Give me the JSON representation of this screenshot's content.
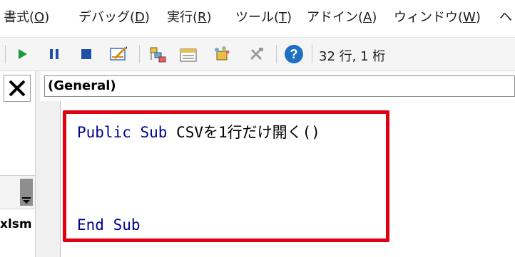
{
  "menu": [
    {
      "id": "format",
      "label": "書式(",
      "key": "O",
      "suffix": ")"
    },
    {
      "id": "debug",
      "label": "デバッグ(",
      "key": "D",
      "suffix": ")"
    },
    {
      "id": "run",
      "label": "実行(",
      "key": "R",
      "suffix": ")"
    },
    {
      "id": "tools",
      "label": "ツール(",
      "key": "T",
      "suffix": ")"
    },
    {
      "id": "addins",
      "label": "アドイン(",
      "key": "A",
      "suffix": ")"
    },
    {
      "id": "window",
      "label": "ウィンドウ(",
      "key": "W",
      "suffix": ")"
    },
    {
      "id": "help",
      "label": "ヘ",
      "key": "",
      "suffix": ""
    }
  ],
  "toolbar": {
    "icons": [
      "run-icon",
      "pause-icon",
      "stop-icon",
      "design-mode-icon",
      "project-explorer-icon",
      "properties-icon",
      "object-browser-icon",
      "toolbox-icon",
      "help-icon"
    ],
    "status": "32 行, 1 桁",
    "colors": {
      "run": "#1a9b3c",
      "pause": "#1f4fa8",
      "stop": "#1f4fa8",
      "help": "#1f6fc2"
    }
  },
  "left_panel": {
    "close_glyph": "✕",
    "file_fragment": "xlsm"
  },
  "editor": {
    "object_combo": "(General)",
    "code": {
      "line1_kw": "Public Sub",
      "line1_rest": " CSVを1行だけ開く()",
      "line2_kw": "End Sub"
    },
    "highlight_color": "#e0000f"
  }
}
